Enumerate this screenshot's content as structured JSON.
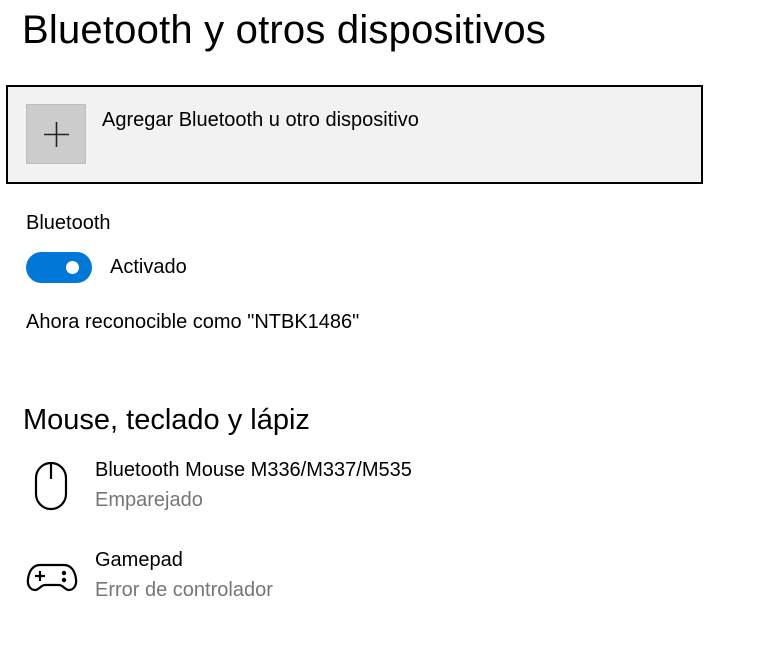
{
  "page": {
    "title": "Bluetooth y otros dispositivos"
  },
  "add_device": {
    "label": "Agregar Bluetooth u otro dispositivo",
    "icon": "plus-icon"
  },
  "bluetooth": {
    "label": "Bluetooth",
    "toggle_on": true,
    "state_label": "Activado",
    "discoverable_text": "Ahora reconocible como \"NTBK1486\"",
    "accent_color": "#0078d7"
  },
  "devices_section": {
    "heading": "Mouse, teclado y lápiz",
    "items": [
      {
        "name": "Bluetooth Mouse M336/M337/M535",
        "status": "Emparejado",
        "icon": "mouse-icon"
      },
      {
        "name": "Gamepad",
        "status": "Error de controlador",
        "icon": "gamepad-icon"
      }
    ]
  }
}
